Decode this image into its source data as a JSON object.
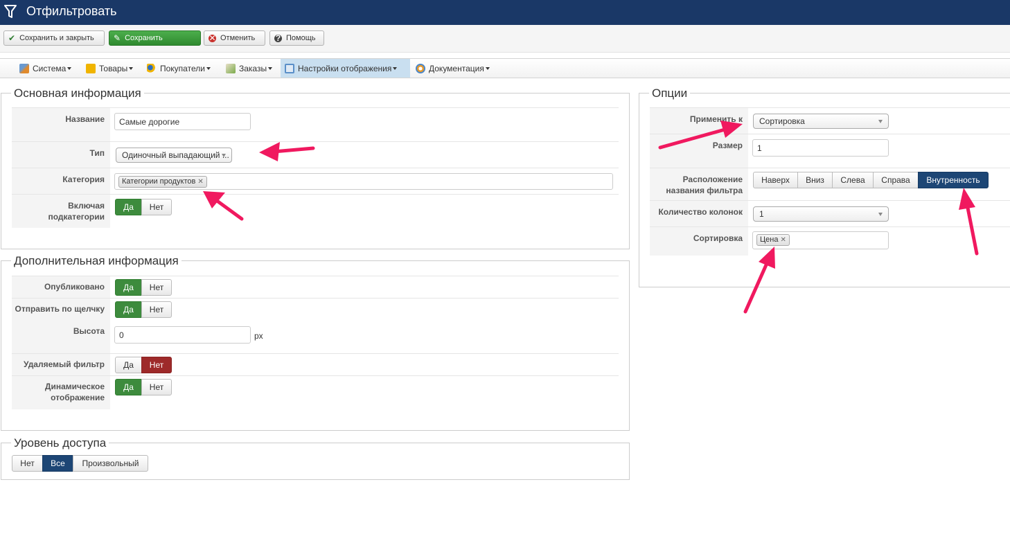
{
  "window": {
    "title": "Отфильтровать",
    "icon": "filter-icon"
  },
  "toolbar": {
    "save_close": "Сохранить и закрыть",
    "save": "Сохранить",
    "cancel": "Отменить",
    "help": "Помощь"
  },
  "menu": {
    "items": [
      {
        "label": "Система",
        "icon": "tools-icon"
      },
      {
        "label": "Товары",
        "icon": "box-icon"
      },
      {
        "label": "Покупатели",
        "icon": "users-icon"
      },
      {
        "label": "Заказы",
        "icon": "orders-icon"
      },
      {
        "label": "Настройки отображения",
        "icon": "display-settings-icon",
        "active": true
      },
      {
        "label": "Документация",
        "icon": "docs-icon"
      }
    ]
  },
  "main_info": {
    "legend": "Основная информация",
    "name_label": "Название",
    "name_value": "Самые дорогие",
    "type_label": "Тип",
    "type_value": "Одиночный выпадающий ...",
    "category_label": "Категория",
    "category_tag": "Категории продуктов",
    "include_label_1": "Включая",
    "include_label_2": "подкатегории",
    "yes": "Да",
    "no": "Нет"
  },
  "extra_info": {
    "legend": "Дополнительная информация",
    "published_label": "Опубликовано",
    "submit_click_label": "Отправить по щелчку",
    "height_label": "Высота",
    "height_value": "0",
    "height_unit": "px",
    "removable_label": "Удаляемый фильтр",
    "dynamic_label_1": "Динамическое",
    "dynamic_label_2": "отображение",
    "yes": "Да",
    "no": "Нет"
  },
  "access": {
    "legend": "Уровень доступа",
    "options": [
      "Нет",
      "Все",
      "Произвольный"
    ],
    "selected": "Все"
  },
  "options": {
    "legend": "Опции",
    "apply_label": "Применить к",
    "apply_value": "Сортировка",
    "size_label": "Размер",
    "size_value": "1",
    "position_label_1": "Расположение",
    "position_label_2": "названия фильтра",
    "position_options": [
      "Наверх",
      "Вниз",
      "Слева",
      "Справа",
      "Внутренность"
    ],
    "position_selected": "Внутренность",
    "columns_label": "Количество колонок",
    "columns_value": "1",
    "sort_label": "Сортировка",
    "sort_tag": "Цена"
  },
  "colors": {
    "titlebar": "#1a3867",
    "green": "#3d8b3d",
    "red": "#9e2a2a",
    "blue": "#1d4675",
    "annotation_arrow": "#f0195f"
  }
}
